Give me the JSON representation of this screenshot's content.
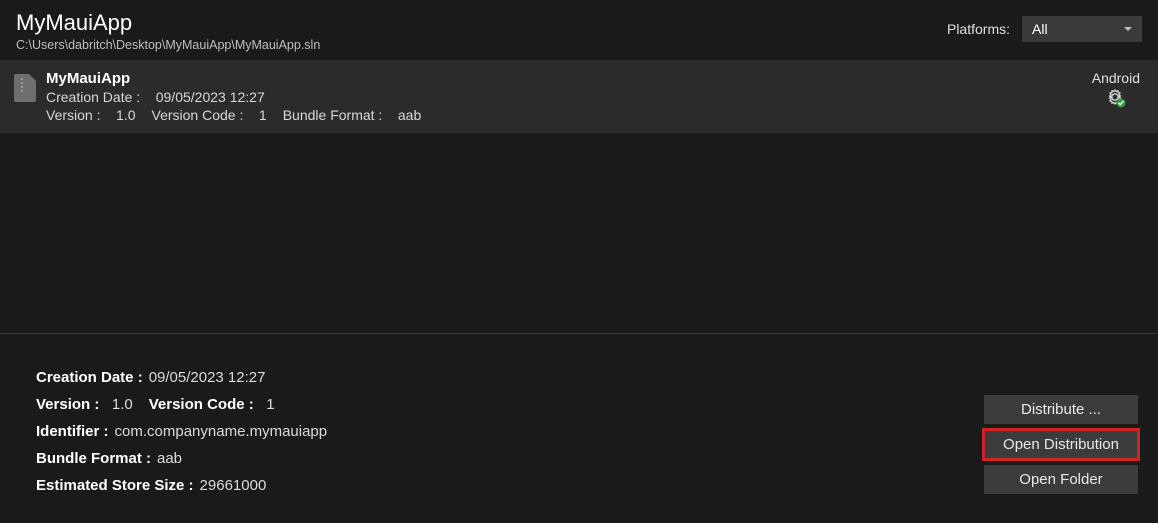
{
  "header": {
    "title": "MyMauiApp",
    "path": "C:\\Users\\dabritch\\Desktop\\MyMauiApp\\MyMauiApp.sln",
    "platforms_label": "Platforms:",
    "platforms_value": "All"
  },
  "archive": {
    "name": "MyMauiApp",
    "creation_date_label": "Creation Date :",
    "creation_date_value": "09/05/2023 12:27",
    "version_label": "Version :",
    "version_value": "1.0",
    "version_code_label": "Version Code :",
    "version_code_value": "1",
    "bundle_format_label": "Bundle Format :",
    "bundle_format_value": "aab",
    "platform": "Android"
  },
  "details": {
    "creation_date_label": "Creation Date :",
    "creation_date_value": "09/05/2023 12:27",
    "version_label": "Version :",
    "version_value": "1.0",
    "version_code_label": "Version Code :",
    "version_code_value": "1",
    "identifier_label": "Identifier :",
    "identifier_value": "com.companyname.mymauiapp",
    "bundle_format_label": "Bundle Format :",
    "bundle_format_value": "aab",
    "estimated_store_size_label": "Estimated Store Size :",
    "estimated_store_size_value": "29661000"
  },
  "buttons": {
    "distribute": "Distribute ...",
    "open_distribution": "Open Distribution",
    "open_folder": "Open Folder"
  }
}
